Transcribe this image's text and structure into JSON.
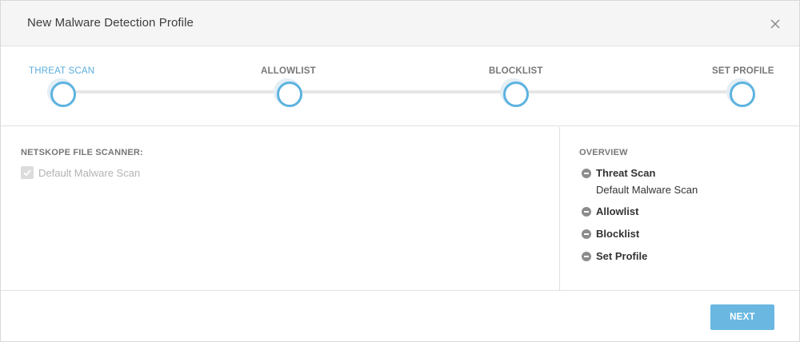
{
  "modal": {
    "title": "New Malware Detection Profile",
    "close_icon": "close-icon"
  },
  "stepper": {
    "steps": [
      {
        "label": "THREAT SCAN",
        "active": true
      },
      {
        "label": "ALLOWLIST",
        "active": false
      },
      {
        "label": "BLOCKLIST",
        "active": false
      },
      {
        "label": "SET PROFILE",
        "active": false
      }
    ]
  },
  "scanner": {
    "section_label": "NETSKOPE FILE SCANNER:",
    "option_label": "Default Malware Scan",
    "option_checked": true,
    "option_disabled": true
  },
  "overview": {
    "label": "OVERVIEW",
    "items": [
      {
        "title": "Threat Scan",
        "detail": "Default Malware Scan"
      },
      {
        "title": "Allowlist"
      },
      {
        "title": "Blocklist"
      },
      {
        "title": "Set Profile"
      }
    ]
  },
  "footer": {
    "next_label": "NEXT"
  },
  "colors": {
    "accent": "#5db3e0",
    "button": "#6ab8e2",
    "header_bg": "#f5f5f5"
  }
}
